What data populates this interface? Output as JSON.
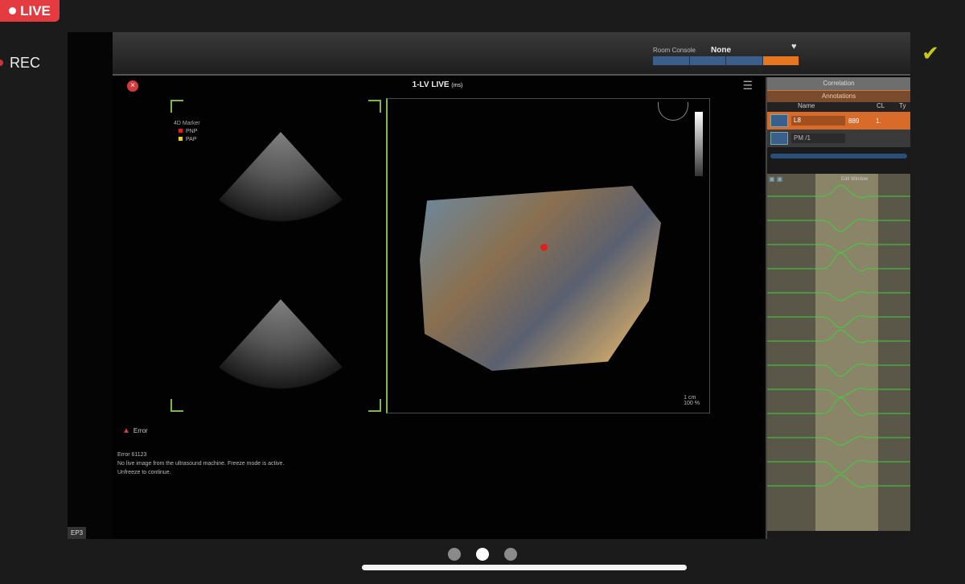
{
  "badge": {
    "live": "LIVE",
    "rec": "REC"
  },
  "topbar": {
    "room_label": "Room Console",
    "room_value": "None"
  },
  "viewer": {
    "title": "1-LV LIVE",
    "title_suffix": "(ms)",
    "marker_title": "4D Marker",
    "markers": [
      {
        "label": "PNP",
        "color": "#e02020"
      },
      {
        "label": "PAP",
        "color": "#e8d020"
      }
    ],
    "scale": "1 cm",
    "scale2": "100 %",
    "error_label": "Error",
    "status_lines": [
      "Error 61123",
      "No live image from the ultrasound machine. Freeze mode is active.",
      "Unfreeze to continue."
    ]
  },
  "ep_label": "EP3",
  "sidebar": {
    "header": "Correlation",
    "sub": "Annotations",
    "col_name": "Name",
    "col_cl": "CL",
    "col_t": "Ty",
    "rows": [
      {
        "name": "L8",
        "cl": "889",
        "t": "1.",
        "active": true
      },
      {
        "name": "PM /1",
        "cl": "",
        "t": "",
        "active": false
      }
    ],
    "signal_title": "Edit Window"
  },
  "pager": {
    "count": 3,
    "active": 1
  },
  "colors": {
    "accent_green": "#7db84c",
    "live_red": "#e33b3f",
    "annotation_orange": "#d86a2a",
    "trace_green": "#3cd23c"
  }
}
